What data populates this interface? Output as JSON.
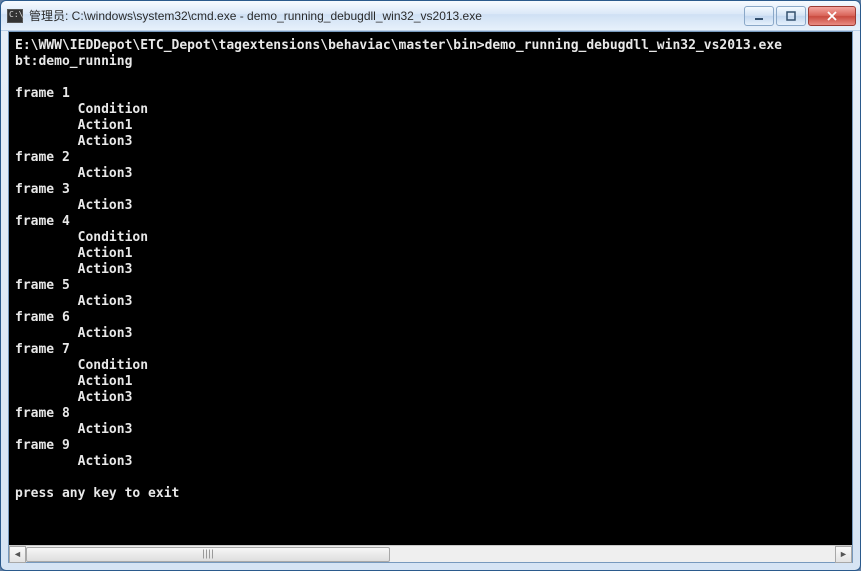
{
  "window": {
    "title": "管理员: C:\\windows\\system32\\cmd.exe - demo_running_debugdll_win32_vs2013.exe"
  },
  "console": {
    "prompt_line": "E:\\WWW\\IEDDepot\\ETC_Depot\\tagextensions\\behaviac\\master\\bin>demo_running_debugdll_win32_vs2013.exe",
    "bt_line": "bt:demo_running",
    "frames": [
      {
        "label": "frame 1",
        "lines": [
          "Condition",
          "Action1",
          "Action3"
        ]
      },
      {
        "label": "frame 2",
        "lines": [
          "Action3"
        ]
      },
      {
        "label": "frame 3",
        "lines": [
          "Action3"
        ]
      },
      {
        "label": "frame 4",
        "lines": [
          "Condition",
          "Action1",
          "Action3"
        ]
      },
      {
        "label": "frame 5",
        "lines": [
          "Action3"
        ]
      },
      {
        "label": "frame 6",
        "lines": [
          "Action3"
        ]
      },
      {
        "label": "frame 7",
        "lines": [
          "Condition",
          "Action1",
          "Action3"
        ]
      },
      {
        "label": "frame 8",
        "lines": [
          "Action3"
        ]
      },
      {
        "label": "frame 9",
        "lines": [
          "Action3"
        ]
      }
    ],
    "exit_line": "press any key to exit",
    "indent": "        "
  }
}
